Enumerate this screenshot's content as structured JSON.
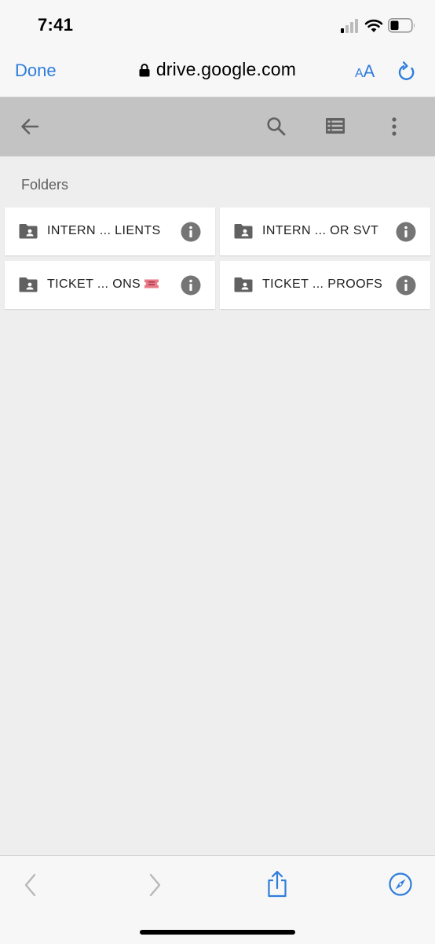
{
  "status_bar": {
    "time": "7:41",
    "icons": [
      "signal-icon",
      "wifi-icon",
      "battery-icon"
    ]
  },
  "browser": {
    "done_label": "Done",
    "url": "drive.google.com",
    "text_size_label_small": "A",
    "text_size_label_large": "A",
    "icons": [
      "lock-icon",
      "reload-icon"
    ]
  },
  "drive_toolbar": {
    "icons": [
      "back-arrow-icon",
      "search-icon",
      "list-view-icon",
      "more-vert-icon"
    ]
  },
  "folders_section": {
    "label": "Folders",
    "items": [
      {
        "name": "INTERN ... LIENTS",
        "icon": "shared-folder-icon"
      },
      {
        "name": "INTERN ... OR SVT",
        "icon": "shared-folder-icon"
      },
      {
        "name": "TICKET ... ONS",
        "icon": "shared-folder-icon",
        "emoji": "ticket-emoji-icon"
      },
      {
        "name": "TICKET ... PROOFS",
        "icon": "shared-folder-icon"
      }
    ]
  },
  "bottom_bar": {
    "icons": [
      "back-chevron-icon",
      "forward-chevron-icon",
      "share-icon",
      "compass-icon"
    ]
  },
  "colors": {
    "accent": "#2f7ddc",
    "toolbar_bg": "#c3c3c3",
    "content_bg": "#eeeeee",
    "icon_gray": "#616161"
  }
}
